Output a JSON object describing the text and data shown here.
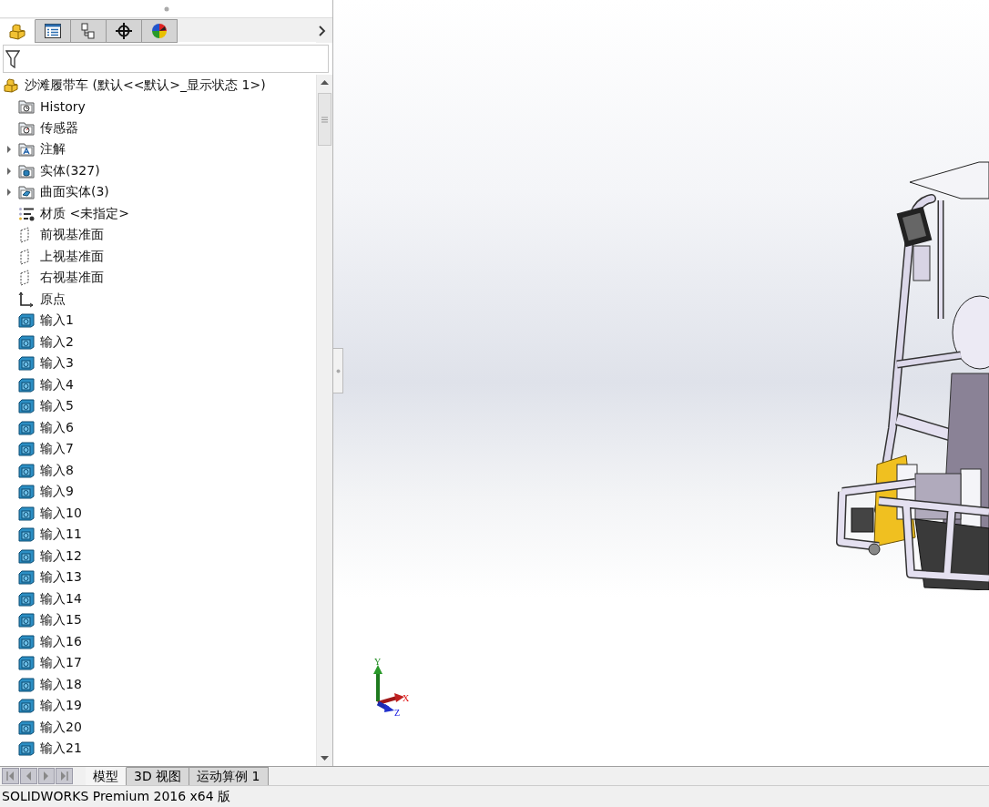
{
  "panel_tabs": [
    {
      "kind": "feature",
      "selected": true
    },
    {
      "kind": "property",
      "selected": false
    },
    {
      "kind": "config",
      "selected": false
    },
    {
      "kind": "target",
      "selected": false
    },
    {
      "kind": "display",
      "selected": false
    }
  ],
  "tree": {
    "label": "沙滩履带车  (默认<<默认>_显示状态 1>)",
    "kind": "part",
    "children": [
      {
        "label": "History",
        "kind": "history"
      },
      {
        "label": "传感器",
        "kind": "sensor"
      },
      {
        "label": "注解",
        "kind": "annotation",
        "expanded": false
      },
      {
        "label": "实体(327)",
        "kind": "solid",
        "expanded": false
      },
      {
        "label": "曲面实体(3)",
        "kind": "surface",
        "expanded": false
      },
      {
        "label": "材质 <未指定>",
        "kind": "material"
      },
      {
        "label": "前视基准面",
        "kind": "plane"
      },
      {
        "label": "上视基准面",
        "kind": "plane"
      },
      {
        "label": "右视基准面",
        "kind": "plane"
      },
      {
        "label": "原点",
        "kind": "origin"
      },
      {
        "label": "输入1",
        "kind": "import"
      },
      {
        "label": "输入2",
        "kind": "import"
      },
      {
        "label": "输入3",
        "kind": "import"
      },
      {
        "label": "输入4",
        "kind": "import"
      },
      {
        "label": "输入5",
        "kind": "import"
      },
      {
        "label": "输入6",
        "kind": "import"
      },
      {
        "label": "输入7",
        "kind": "import"
      },
      {
        "label": "输入8",
        "kind": "import"
      },
      {
        "label": "输入9",
        "kind": "import"
      },
      {
        "label": "输入10",
        "kind": "import"
      },
      {
        "label": "输入11",
        "kind": "import"
      },
      {
        "label": "输入12",
        "kind": "import"
      },
      {
        "label": "输入13",
        "kind": "import"
      },
      {
        "label": "输入14",
        "kind": "import"
      },
      {
        "label": "输入15",
        "kind": "import"
      },
      {
        "label": "输入16",
        "kind": "import"
      },
      {
        "label": "输入17",
        "kind": "import"
      },
      {
        "label": "输入18",
        "kind": "import"
      },
      {
        "label": "输入19",
        "kind": "import"
      },
      {
        "label": "输入20",
        "kind": "import"
      },
      {
        "label": "输入21",
        "kind": "import"
      }
    ]
  },
  "triad": {
    "y": "Y",
    "x": "X",
    "z": "Z"
  },
  "sheet_tabs": [
    {
      "label": "模型",
      "selected": true
    },
    {
      "label": "3D 视图",
      "selected": false
    },
    {
      "label": "运动算例 1",
      "selected": false
    }
  ],
  "status_bar": "SOLIDWORKS Premium 2016 x64 版"
}
